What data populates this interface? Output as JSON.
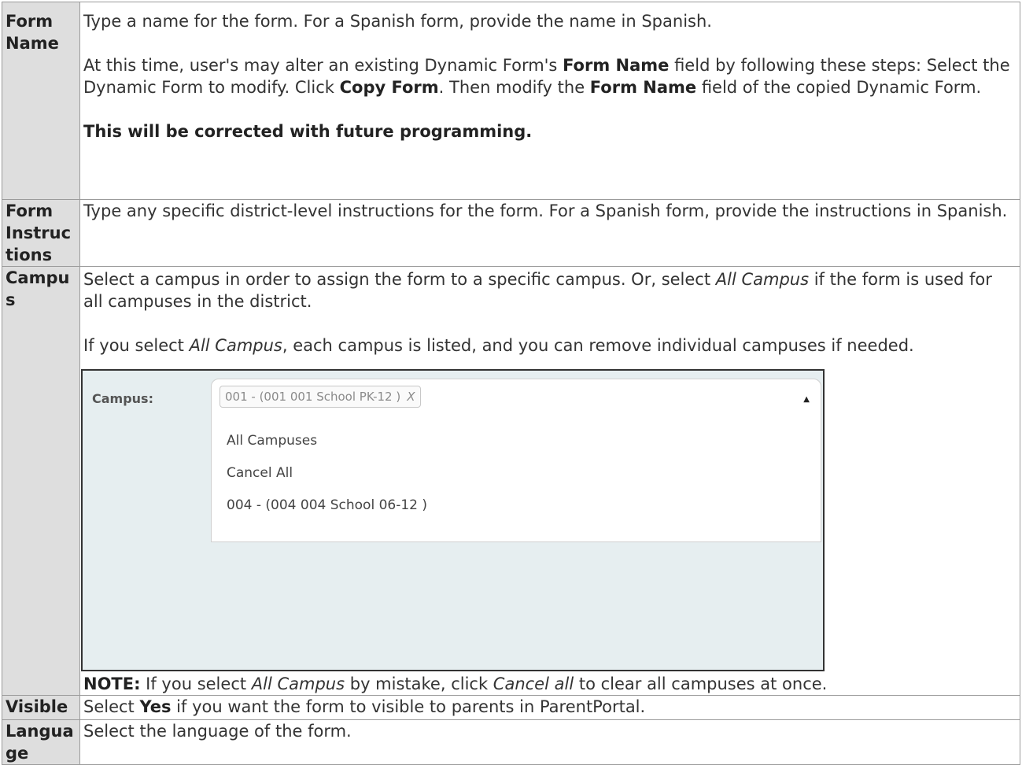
{
  "rows": {
    "form_name": {
      "label": "Form Name",
      "p1": "Type a name for the form. For a Spanish form, provide the name in Spanish.",
      "p2_a": "At this time, user's may alter an existing Dynamic Form's ",
      "p2_b1": "Form Name",
      "p2_c": " field by following these steps: Select the Dynamic Form to modify. Click ",
      "p2_b2": "Copy Form",
      "p2_d": ". Then modify the ",
      "p2_b3": "Form Name",
      "p2_e": " field of the copied Dynamic Form.",
      "p3": "This will be corrected with future programming."
    },
    "form_instructions": {
      "label": "Form Instructions",
      "text": "Type any specific district-level instructions for the form. For a Spanish form, provide the instructions in Spanish."
    },
    "campus": {
      "label": "Campus",
      "p1_a": "Select a campus in order to assign the form to a specific campus. Or, select ",
      "p1_i": "All Campus",
      "p1_b": " if the form is used for all campuses in the district.",
      "p2_a": "If you select ",
      "p2_i": "All Campus",
      "p2_b": ", each campus is listed, and you can remove individual campuses if needed.",
      "screenshot": {
        "label": "Campus:",
        "selected_chip": "001 - (001 001 School PK-12 )",
        "chip_remove": "X",
        "options": [
          "All Campuses",
          "Cancel All",
          "004 - (004 004 School 06-12 )"
        ]
      },
      "note_b": "NOTE:",
      "note_a": " If you select ",
      "note_i1": "All Campus",
      "note_c": " by mistake, click ",
      "note_i2": "Cancel all",
      "note_d": " to clear all campuses at once."
    },
    "visible": {
      "label": "Visible",
      "t_a": "Select ",
      "t_b": "Yes",
      "t_c": " if you want the form to visible to parents in ParentPortal."
    },
    "language": {
      "label": "Language",
      "text": "Select the language of the form."
    }
  }
}
